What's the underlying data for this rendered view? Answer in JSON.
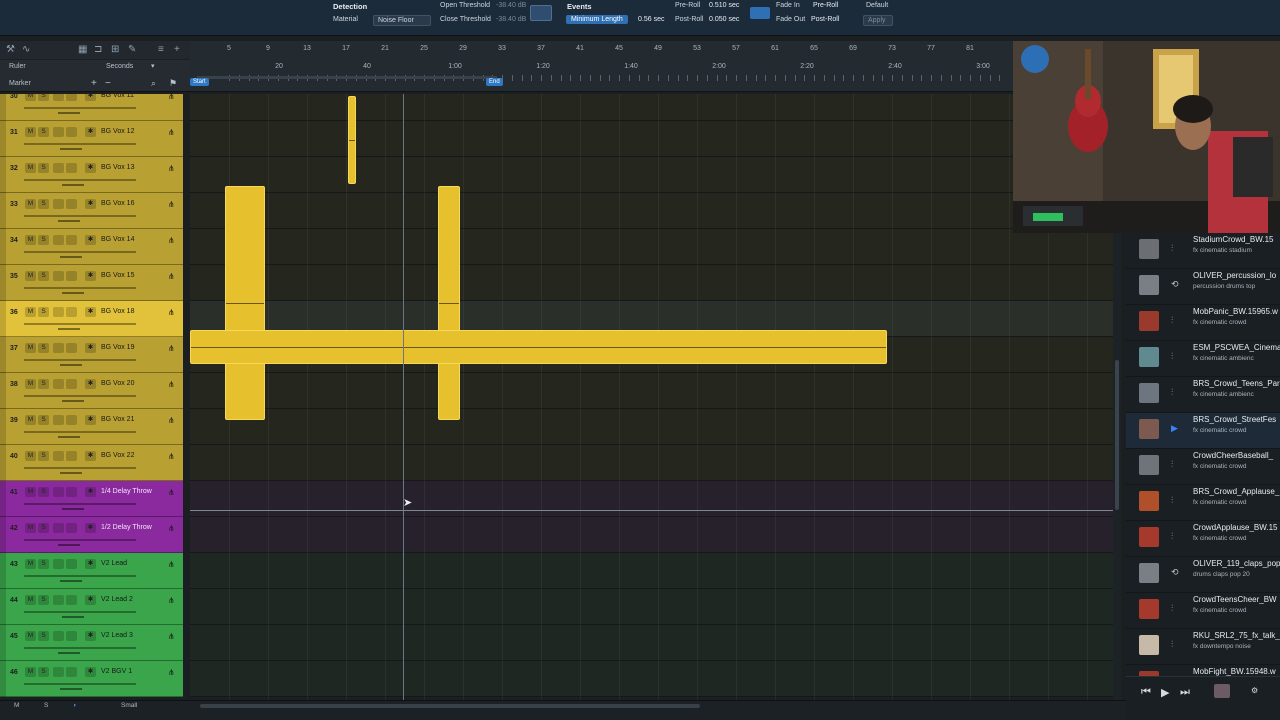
{
  "topbar": {
    "detection_label": "Detection",
    "material_label": "Material",
    "material_value": "Noise Floor",
    "open_threshold_label": "Open Threshold",
    "open_threshold_value": "-38.40 dB",
    "close_threshold_label": "Close Threshold",
    "close_threshold_value": "-38.40 dB",
    "events_label": "Events",
    "min_length_label": "Minimum Length",
    "min_length_value": "0.56 sec",
    "pre_roll_label": "Pre-Roll",
    "pre_roll_value": "0.510 sec",
    "post_roll_label": "Post-Roll",
    "post_roll_value": "0.050 sec",
    "fade_in_label": "Fade In",
    "fade_out_label": "Fade Out",
    "fade_in_value": "Pre-Roll",
    "fade_out_value": "Post-Roll",
    "default_label": "Default",
    "apply_label": "Apply"
  },
  "ruler_panel": {
    "ruler_label": "Ruler",
    "ruler_units": "Seconds",
    "marker_label": "Marker",
    "start_marker": "Start",
    "end_marker": "End"
  },
  "ruler": {
    "bars": [
      "5",
      "9",
      "13",
      "17",
      "21",
      "25",
      "29",
      "33",
      "37",
      "41",
      "45",
      "49",
      "53",
      "57",
      "61",
      "65",
      "69",
      "73",
      "77",
      "81"
    ],
    "times": [
      "20",
      "40",
      "1:00",
      "1:20",
      "1:40",
      "2:00",
      "2:20",
      "2:40",
      "3:00"
    ]
  },
  "tracks": [
    {
      "num": "30",
      "name": "BG Vox 11",
      "color": "#b8a032"
    },
    {
      "num": "31",
      "name": "BG Vox 12",
      "color": "#b8a032"
    },
    {
      "num": "32",
      "name": "BG Vox 13",
      "color": "#b8a032"
    },
    {
      "num": "33",
      "name": "BG Vox 16",
      "color": "#b8a032"
    },
    {
      "num": "34",
      "name": "BG Vox 14",
      "color": "#b8a032"
    },
    {
      "num": "35",
      "name": "BG Vox 15",
      "color": "#b8a032"
    },
    {
      "num": "36",
      "name": "BG Vox 18",
      "color": "#e2c23a"
    },
    {
      "num": "37",
      "name": "BG Vox 19",
      "color": "#b8a032"
    },
    {
      "num": "38",
      "name": "BG Vox 20",
      "color": "#b8a032"
    },
    {
      "num": "39",
      "name": "BG Vox 21",
      "color": "#b8a032"
    },
    {
      "num": "40",
      "name": "BG Vox 22",
      "color": "#b8a032"
    },
    {
      "num": "41",
      "name": "1/4 Delay Throw",
      "color": "#8b2a9e"
    },
    {
      "num": "42",
      "name": "1/2 Delay Throw",
      "color": "#8b2a9e"
    },
    {
      "num": "43",
      "name": "V2 Lead",
      "color": "#3aa54a"
    },
    {
      "num": "44",
      "name": "V2 Lead 2",
      "color": "#3aa54a"
    },
    {
      "num": "45",
      "name": "V2 Lead 3",
      "color": "#3aa54a"
    },
    {
      "num": "46",
      "name": "V2 BGV 1",
      "color": "#3aa54a"
    }
  ],
  "browser": [
    {
      "title": "StadiumCrowd_BW.15",
      "tags": "fx  cinematic  stadium",
      "icon": "waveform-icon",
      "thumb": "#6b6f74"
    },
    {
      "title": "OLIVER_percussion_lo",
      "tags": "percussion  drums  top",
      "icon": "loop-icon",
      "thumb": "#7a7f86"
    },
    {
      "title": "MobPanic_BW.15965.w",
      "tags": "fx  cinematic  crowd",
      "icon": "waveform-icon",
      "thumb": "#9a3a2c"
    },
    {
      "title": "ESM_PSCWEA_Cinema",
      "tags": "fx  cinematic  ambienc",
      "icon": "waveform-icon",
      "thumb": "#5f8a8f"
    },
    {
      "title": "BRS_Crowd_Teens_Par",
      "tags": "fx  cinematic  ambienc",
      "icon": "waveform-icon",
      "thumb": "#6d7680"
    },
    {
      "title": "BRS_Crowd_StreetFes",
      "tags": "fx  cinematic  crowd",
      "icon": "play-icon",
      "thumb": "#7c5a4f"
    },
    {
      "title": "CrowdCheerBaseball_",
      "tags": "fx  cinematic  crowd",
      "icon": "waveform-icon",
      "thumb": "#6f747a"
    },
    {
      "title": "BRS_Crowd_Applause_",
      "tags": "fx  cinematic  crowd",
      "icon": "waveform-icon",
      "thumb": "#b0502a"
    },
    {
      "title": "CrowdApplause_BW.15",
      "tags": "fx  cinematic  crowd",
      "icon": "waveform-icon",
      "thumb": "#a5392b"
    },
    {
      "title": "OLIVER_119_claps_pop",
      "tags": "drums  claps  pop  20",
      "icon": "loop-icon",
      "thumb": "#7a7f86"
    },
    {
      "title": "CrowdTeensCheer_BW",
      "tags": "fx  cinematic  crowd",
      "icon": "waveform-icon",
      "thumb": "#a5392b"
    },
    {
      "title": "RKU_SRL2_75_fx_talk_",
      "tags": "fx  downtempo  noise",
      "icon": "waveform-icon",
      "thumb": "#c7b9a8"
    },
    {
      "title": "MobFight_BW.15948.w",
      "tags": "",
      "icon": "waveform-icon",
      "thumb": "#9a3a2c"
    }
  ],
  "bottom": {
    "m_label": "M",
    "s_label": "S",
    "size_label": "Small"
  }
}
